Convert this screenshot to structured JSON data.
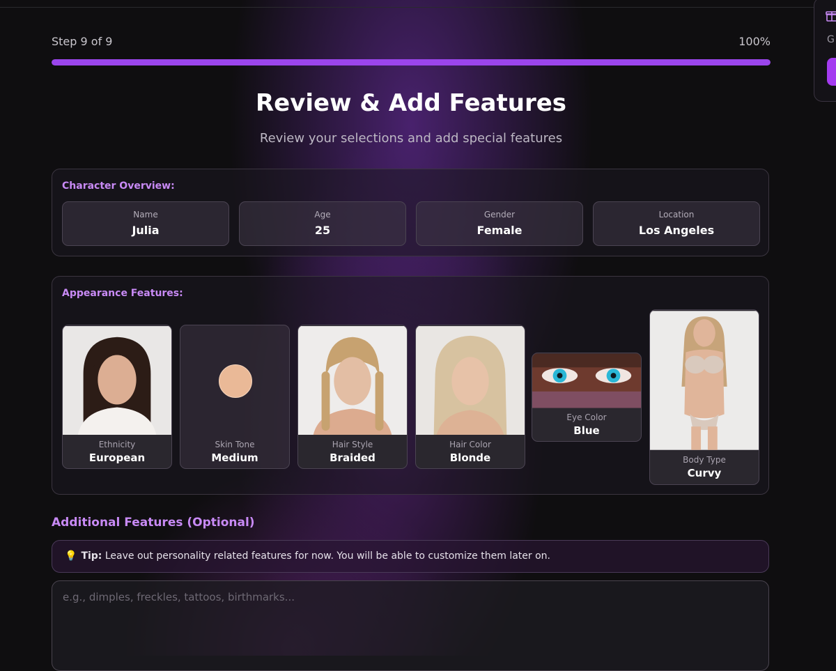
{
  "progress": {
    "step_text": "Step 9 of 9",
    "percent_text": "100%",
    "fraction": 1.0
  },
  "header": {
    "title": "Review & Add Features",
    "subtitle": "Review your selections and add special features"
  },
  "overview": {
    "heading": "Character Overview:",
    "items": [
      {
        "label": "Name",
        "value": "Julia"
      },
      {
        "label": "Age",
        "value": "25"
      },
      {
        "label": "Gender",
        "value": "Female"
      },
      {
        "label": "Location",
        "value": "Los Angeles"
      }
    ]
  },
  "appearance": {
    "heading": "Appearance Features:",
    "items": [
      {
        "label": "Ethnicity",
        "value": "European"
      },
      {
        "label": "Skin Tone",
        "value": "Medium",
        "swatch_color": "#eab997"
      },
      {
        "label": "Hair Style",
        "value": "Braided"
      },
      {
        "label": "Hair Color",
        "value": "Blonde"
      },
      {
        "label": "Eye Color",
        "value": "Blue"
      },
      {
        "label": "Body Type",
        "value": "Curvy"
      }
    ]
  },
  "additional": {
    "heading": "Additional Features (Optional)",
    "tip_label": "Tip:",
    "tip_text": "Leave out personality related features for now. You will be able to customize them later on.",
    "placeholder": "e.g., dimples, freckles, tattoos, birthmarks..."
  },
  "side_widget": {
    "label": "G",
    "icon": "gift-icon"
  },
  "colors": {
    "accent": "#9b45ec",
    "heading_purple": "#c88af5",
    "background": "#0f0e10"
  }
}
